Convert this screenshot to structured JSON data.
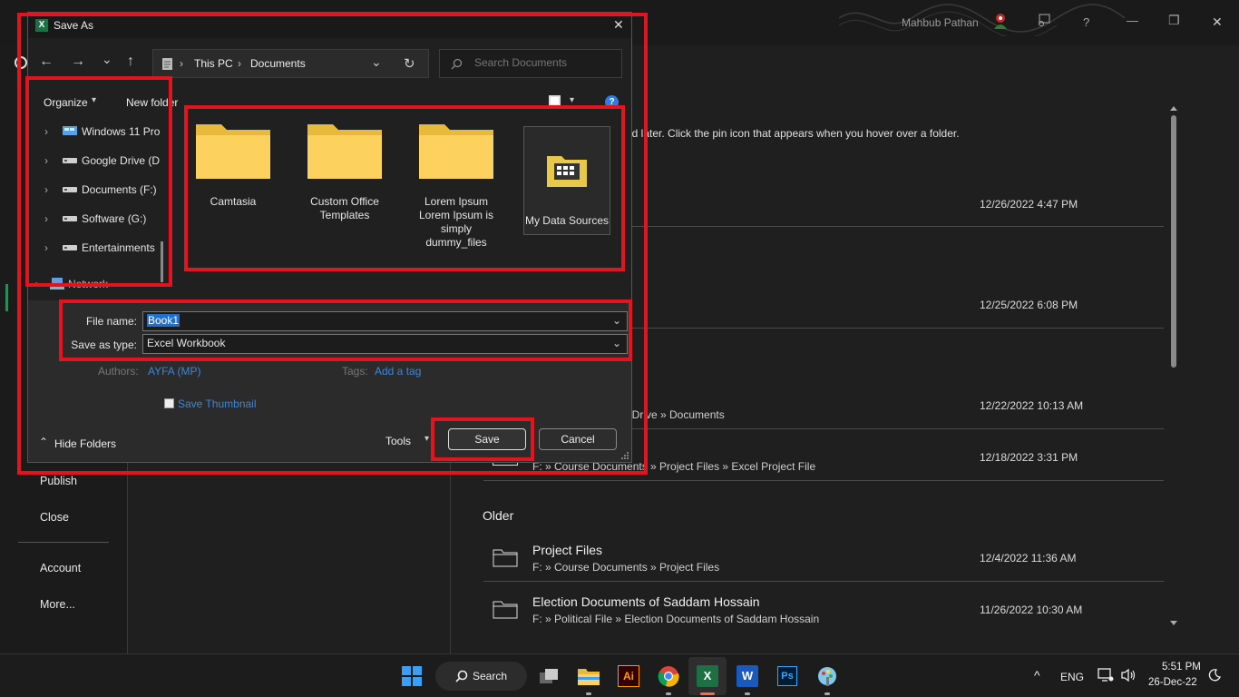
{
  "window": {
    "user_name": "Mahbub Pathan",
    "controls": {
      "help": "?",
      "restore": "❐",
      "close": "✕",
      "minimize": "—"
    }
  },
  "backstage": {
    "nav": {
      "publish": "Publish",
      "close": "Close",
      "account": "Account",
      "more": "More..."
    },
    "pin_hint": "nd later. Click the pin icon that appears when you hover over a folder.",
    "recent": [
      {
        "title": "",
        "path": "",
        "date": "12/26/2022 4:47 PM"
      },
      {
        "title": "",
        "path": "",
        "date": "12/25/2022 6:08 PM"
      },
      {
        "title": "",
        "path": "eDrive » Documents",
        "date": "12/22/2022 10:13 AM"
      },
      {
        "title": "",
        "path": "F: » Course Documents » Project Files » Excel Project File",
        "date": "12/18/2022 3:31 PM"
      }
    ],
    "older_label": "Older",
    "older": [
      {
        "title": "Project Files",
        "path": "F: » Course Documents » Project Files",
        "date": "12/4/2022 11:36 AM"
      },
      {
        "title": "Election Documents of Saddam Hossain",
        "path": "F: » Political File » Election Documents of Saddam Hossain",
        "date": "11/26/2022 10:30 AM"
      }
    ]
  },
  "dialog": {
    "title": "Save As",
    "app_badge": "X",
    "close": "✕",
    "nav": {
      "back": "←",
      "forward": "→",
      "recent": "⌄",
      "up": "↑"
    },
    "address": {
      "sep": "›",
      "crumb1": "This PC",
      "crumb2": "Documents",
      "dropdown": "⌄",
      "refresh": "↻"
    },
    "search_placeholder": "Search Documents",
    "cmd": {
      "organize": "Organize",
      "caret": "▾",
      "new_folder": "New folder",
      "help": "?"
    },
    "tree": [
      {
        "label": "Windows 11 Pro",
        "chevron": "›"
      },
      {
        "label": "Google Drive (D",
        "chevron": "›"
      },
      {
        "label": "Documents (F:)",
        "chevron": "›"
      },
      {
        "label": "Software (G:)",
        "chevron": "›"
      },
      {
        "label": "Entertainments",
        "chevron": "›"
      },
      {
        "label": "Network",
        "chevron": "›"
      }
    ],
    "files": [
      {
        "name": "Camtasia"
      },
      {
        "name": "Custom Office Templates"
      },
      {
        "name": "Lorem Ipsum Lorem Ipsum is simply dummy_files"
      },
      {
        "name": "My Data Sources"
      }
    ],
    "file_name_label": "File name:",
    "file_name_value": "Book1",
    "save_type_label": "Save as type:",
    "save_type_value": "Excel Workbook",
    "authors_label": "Authors:",
    "authors_value": "AYFA (MP)",
    "tags_label": "Tags:",
    "tags_value": "Add a tag",
    "save_thumbnail": "Save Thumbnail",
    "hide_folders": "Hide Folders",
    "hide_caret": "⌃",
    "tools": "Tools",
    "save": "Save",
    "cancel": "Cancel"
  },
  "taskbar": {
    "search": "Search",
    "lang": "ENG",
    "time": "5:51 PM",
    "date": "26-Dec-22",
    "overflow": "^",
    "apps": {
      "ai": "Ai",
      "ps": "Ps",
      "excel": "X",
      "word": "W"
    }
  },
  "colors": {
    "accent_red": "#e3141e",
    "excel_green": "#1d7044",
    "link_blue": "#4ea1ff"
  }
}
